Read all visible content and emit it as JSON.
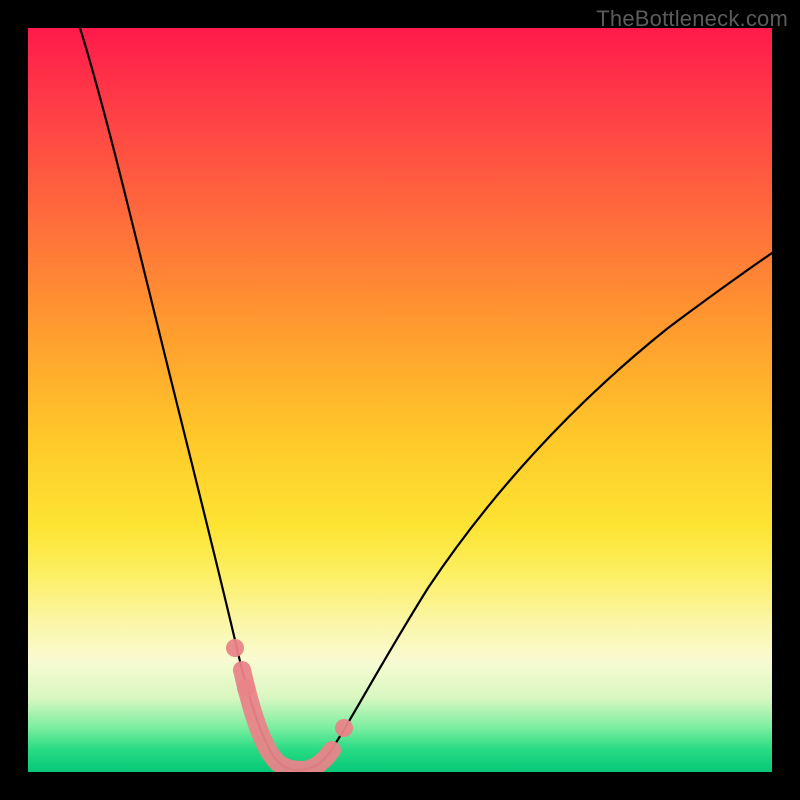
{
  "watermark": "TheBottleneck.com",
  "chart_data": {
    "type": "line",
    "title": "",
    "xlabel": "",
    "ylabel": "",
    "x_range": [
      0,
      100
    ],
    "y_range": [
      0,
      100
    ],
    "series": [
      {
        "name": "bottleneck-curve",
        "x": [
          7,
          10,
          14,
          18,
          22,
          25,
          27,
          29,
          31,
          32.5,
          34,
          36,
          38,
          40,
          44,
          50,
          58,
          68,
          80,
          92,
          100
        ],
        "values": [
          100,
          84,
          66,
          48,
          33,
          22,
          15,
          9,
          5,
          2,
          1,
          1,
          2,
          4,
          9,
          17,
          28,
          40,
          52,
          62,
          68
        ]
      }
    ],
    "highlight": {
      "name": "optimal-range",
      "x_start": 28,
      "x_end": 41,
      "label": ""
    },
    "background_gradient": {
      "top": "#ff1a4b",
      "mid": "#fde433",
      "bottom": "#07c878"
    }
  }
}
